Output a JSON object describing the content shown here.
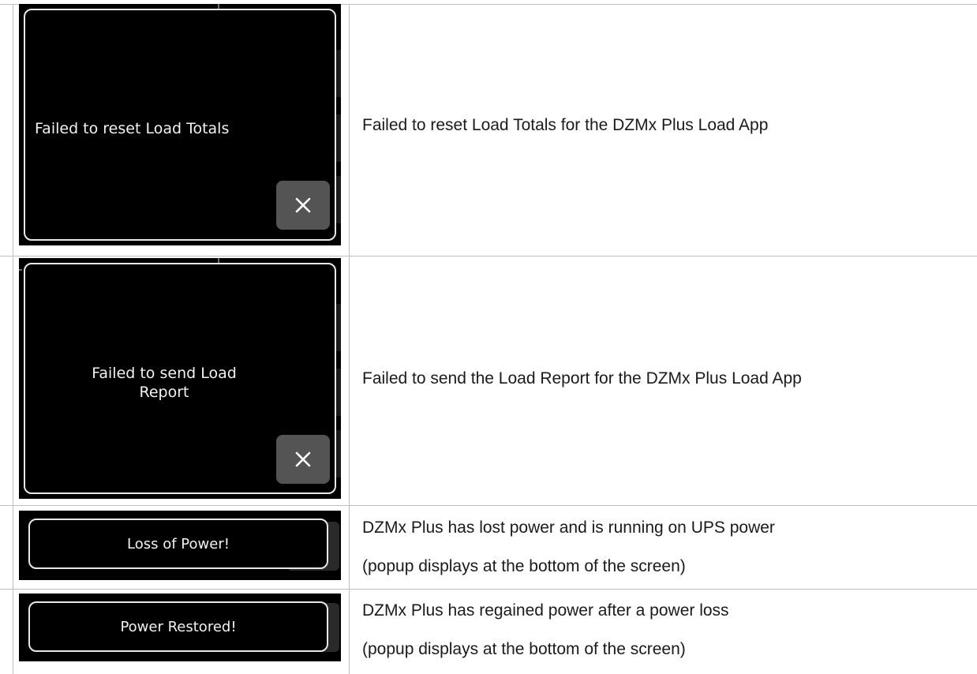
{
  "rows": [
    {
      "popup_text": "Failed to reset Load Totals",
      "description": "Failed to reset Load Totals for the DZMx Plus Load App",
      "close_icon": "close-icon"
    },
    {
      "popup_text_line1": "Failed to send Load",
      "popup_text_line2": "Report",
      "description": "Failed to send the Load Report for the DZMx Plus Load App",
      "close_icon": "close-icon"
    },
    {
      "banner_text": "Loss of Power!",
      "description_line1": "DZMx Plus has lost power and is running on UPS power",
      "description_line2": "(popup displays at the bottom of the screen)"
    },
    {
      "banner_text": "Power Restored!",
      "description_line1": "DZMx Plus has regained power after a power loss",
      "description_line2": "(popup displays at the bottom of the screen)"
    }
  ],
  "colors": {
    "screen_background": "#000000",
    "popup_border": "#e8e8e8",
    "close_button": "#545454",
    "table_border": "#bfbfbf"
  }
}
